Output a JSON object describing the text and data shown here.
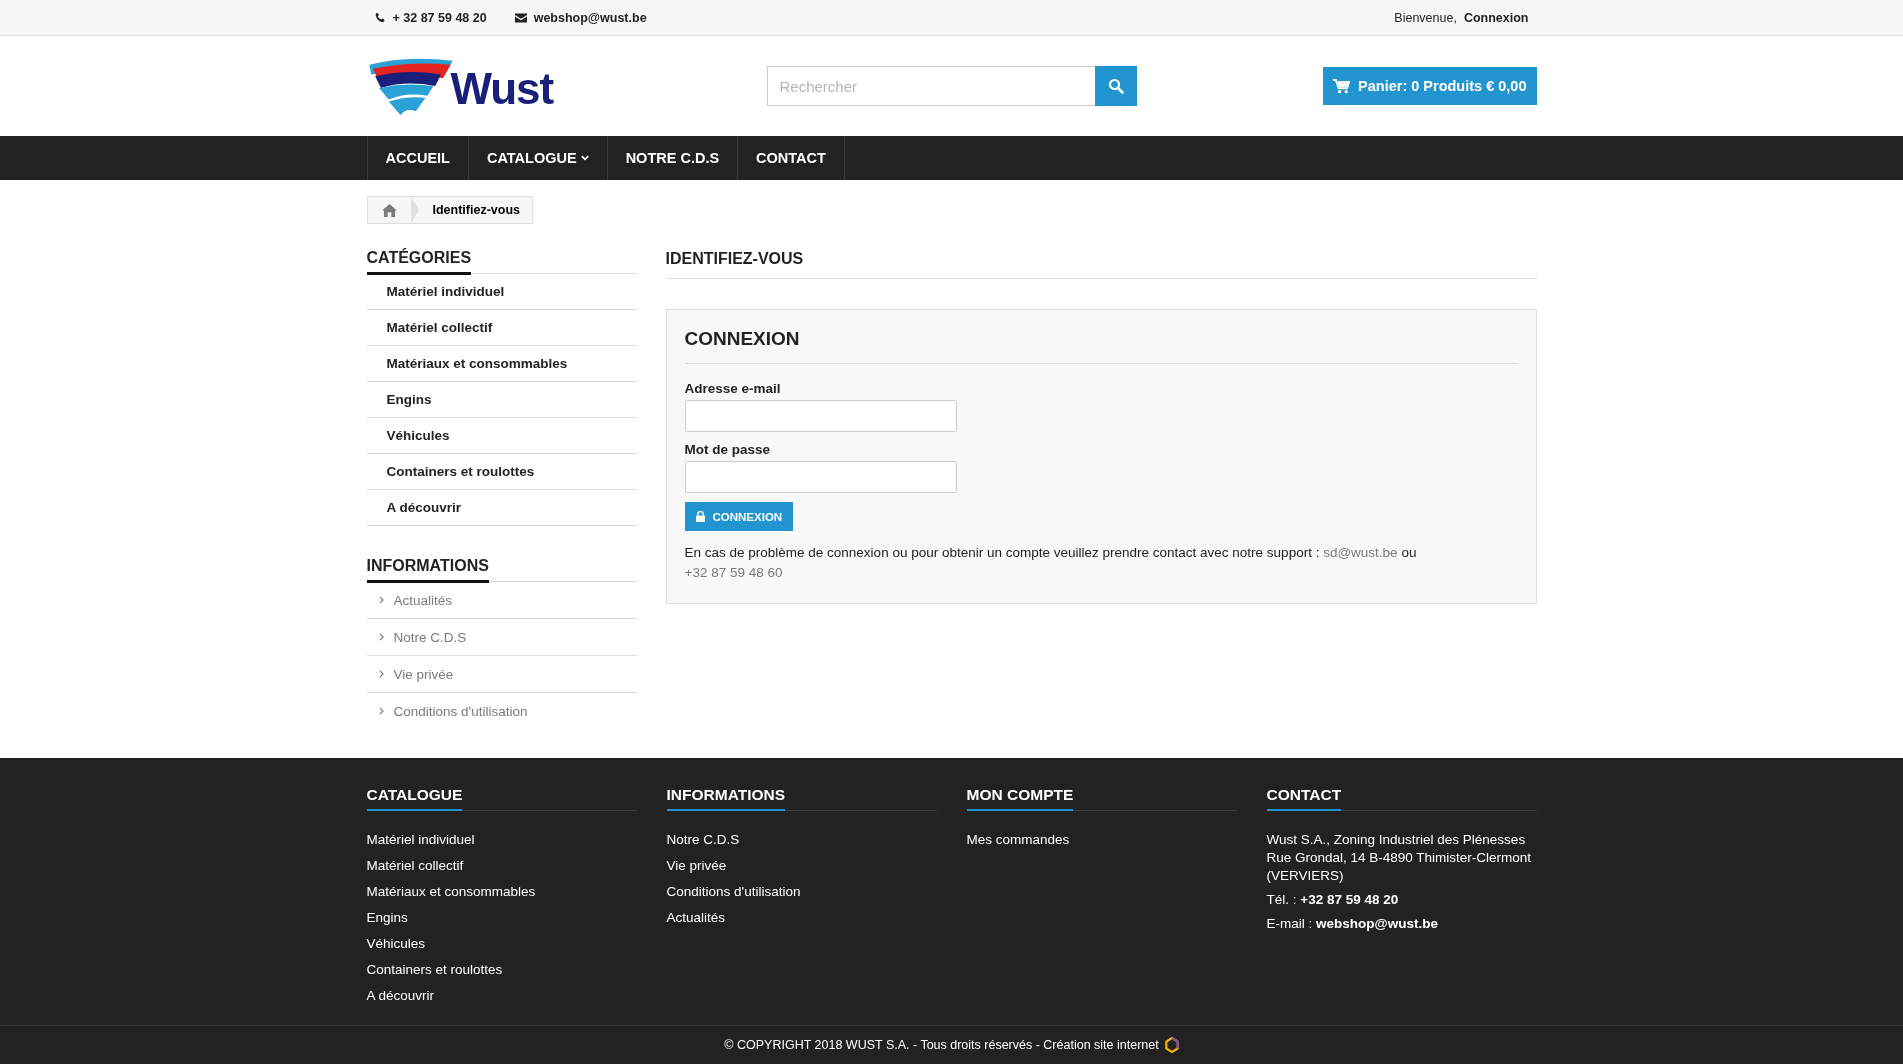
{
  "top_bar": {
    "phone": "+ 32 87 59 48 20",
    "email": "webshop@wust.be",
    "greeting": "Bienvenue,",
    "login_link": "Connexion"
  },
  "header": {
    "logo_text": "Wust",
    "search": {
      "placeholder": "Rechercher"
    },
    "cart": "Panier: 0 Produits € 0,00"
  },
  "nav": [
    {
      "label": "ACCUEIL",
      "has_dropdown": false
    },
    {
      "label": "CATALOGUE",
      "has_dropdown": true
    },
    {
      "label": "NOTRE C.D.S",
      "has_dropdown": false
    },
    {
      "label": "CONTACT",
      "has_dropdown": false
    }
  ],
  "breadcrumb": {
    "current": "Identifiez-vous"
  },
  "sidebar": [
    {
      "kind": "categories",
      "title": "CATÉGORIES",
      "items": [
        "Matériel individuel",
        "Matériel collectif",
        "Matériaux et consommables",
        "Engins",
        "Véhicules",
        "Containers et roulottes",
        "A découvrir"
      ]
    },
    {
      "kind": "links",
      "title": "INFORMATIONS",
      "items": [
        "Actualités",
        "Notre C.D.S",
        "Vie privée",
        "Conditions d'utilisation"
      ]
    }
  ],
  "page_title": "IDENTIFIEZ-VOUS",
  "login": {
    "title": "CONNEXION",
    "email_label": "Adresse e-mail",
    "password_label": "Mot de passe",
    "button": "CONNEXION",
    "help_text": "En cas de problème de connexion ou pour obtenir un compte veuillez prendre contact avec notre support :",
    "help_email": "sd@wust.be",
    "help_or": "ou",
    "help_phone": "+32 87 59 48 60"
  },
  "footer": {
    "columns": [
      {
        "title": "CATALOGUE",
        "links": [
          "Matériel individuel",
          "Matériel collectif",
          "Matériaux et consommables",
          "Engins",
          "Véhicules",
          "Containers et roulottes",
          "A découvrir"
        ]
      },
      {
        "title": "INFORMATIONS",
        "links": [
          "Notre C.D.S",
          "Vie privée",
          "Conditions d'utilisation",
          "Actualités"
        ]
      },
      {
        "title": "MON COMPTE",
        "links": [
          "Mes commandes"
        ]
      }
    ],
    "contact": {
      "title": "CONTACT",
      "address": "Wust S.A., Zoning Industriel des Plénesses Rue Grondal, 14 B-4890 Thimister-Clermont (VERVIERS)",
      "phone": "Tél. : **+32 87 59 48 20**",
      "email": "E-mail : **webshop@wust.be**"
    },
    "copyright": "© COPYRIGHT 2018 WUST S.A. - Tous droits réservés - Création site internet"
  }
}
